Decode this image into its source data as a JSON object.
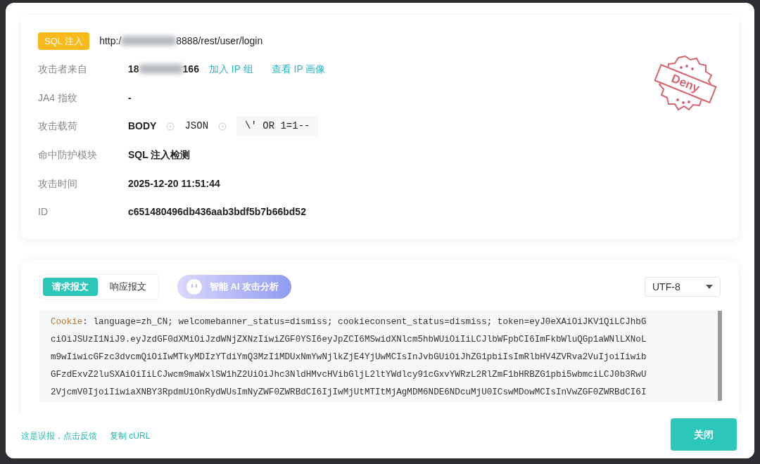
{
  "attack": {
    "tag": "SQL 注入",
    "url_prefix": "http:/",
    "url_suffix": "8888/rest/user/login",
    "stamp": "Deny"
  },
  "details": [
    {
      "kind": "ip",
      "label": "攻击者来自",
      "ip_prefix": "18",
      "ip_suffix": "166",
      "links": [
        "加入 IP 组",
        "查看 IP 画像"
      ]
    },
    {
      "kind": "text",
      "label": "JA4 指纹",
      "value": "-"
    },
    {
      "kind": "payload",
      "label": "攻击载荷",
      "parts": [
        "BODY",
        "JSON"
      ],
      "code": "\\' OR 1=1--"
    },
    {
      "kind": "text",
      "label": "命中防护模块",
      "value": "SQL 注入检测"
    },
    {
      "kind": "text",
      "label": "攻击时间",
      "value": "2025-12-20 11:51:44"
    },
    {
      "kind": "text",
      "label": "ID",
      "value": "c651480496db436aab3bdf5b7b66bd52"
    }
  ],
  "tabs": [
    {
      "label": "请求报文",
      "selected": true
    },
    {
      "label": "响应报文",
      "selected": false
    }
  ],
  "ai_button": "智能 AI 攻击分析",
  "encoding": "UTF-8",
  "message": {
    "header_name": "Cookie",
    "lines": [
      ": language=zh_CN; welcomebanner_status=dismiss; cookieconsent_status=dismiss; token=eyJ0eXAiOiJKV1QiLCJhbG",
      "ciOiJSUzI1NiJ9.eyJzdGF0dXMiOiJzdWNjZXNzIiwiZGF0YSI6eyJpZCI6MSwidXNlcm5hbWUiOiIiLCJlbWFpbCI6ImFkbWluQGp1aWNlLXNoL",
      "m9wIiwicGFzc3dvcmQiOiIwMTkyMDIzYTdiYmQ3MzI1MDUxNmYwNjlkZjE4YjUwMCIsInJvbGUiOiJhZG1pbiIsImRlbHV4ZVRva2VuIjoiIiwib",
      "GFzdExvZ2luSXAiOiIiLCJwcm9maWxlSW1hZ2UiOiJhc3NldHMvcHVibGljL2ltYWdlcy91cGxvYWRzL2RlZmF1bHRBZG1pbi5wbmciLCJ0b3RwU",
      "2VjcmV0IjoiIiwiaXNBY3RpdmUiOnRydWUsImNyZWF0ZWRBdCI6IjIwMjUtMTItMjAgMDM6NDE6NDcuMjU0ICswMDowMCIsInVwZGF0ZWRBdCI6I"
    ]
  },
  "footer_links": [
    "这是误报，点击反馈",
    "复制 cURL"
  ],
  "close_button": "关闭"
}
